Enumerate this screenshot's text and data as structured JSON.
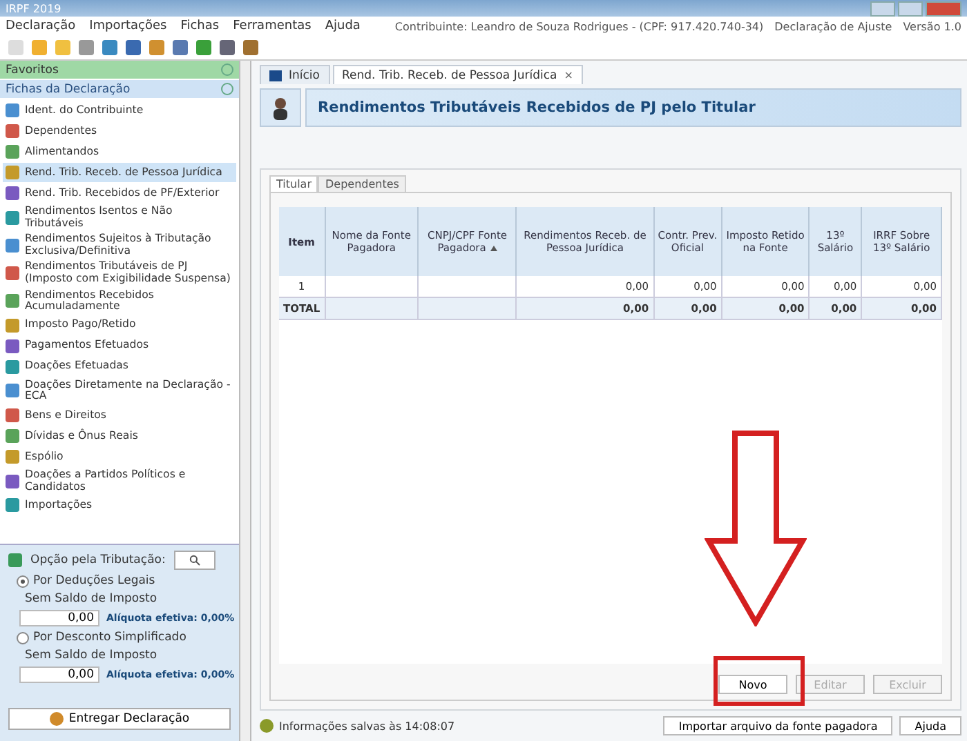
{
  "window": {
    "title": "IRPF 2019"
  },
  "menu": [
    "Declaração",
    "Importações",
    "Fichas",
    "Ferramentas",
    "Ajuda"
  ],
  "header_info": {
    "taxpayer": "Contribuinte: Leandro de Souza Rodrigues - (CPF: 917.420.740-34)",
    "declaration": "Declaração de Ajuste",
    "version": "Versão 1.0"
  },
  "sidebar": {
    "favorites": "Favoritos",
    "section": "Fichas da Declaração",
    "items": [
      {
        "label": "Ident. do Contribuinte",
        "selected": false
      },
      {
        "label": "Dependentes",
        "selected": false
      },
      {
        "label": "Alimentandos",
        "selected": false
      },
      {
        "label": "Rend. Trib. Receb. de Pessoa Jurídica",
        "selected": true
      },
      {
        "label": "Rend. Trib. Recebidos de PF/Exterior",
        "selected": false
      },
      {
        "label": "Rendimentos Isentos e Não Tributáveis",
        "selected": false
      },
      {
        "label": "Rendimentos Sujeitos à Tributação Exclusiva/Definitiva",
        "selected": false
      },
      {
        "label": "Rendimentos Tributáveis de PJ (Imposto com Exigibilidade Suspensa)",
        "selected": false
      },
      {
        "label": "Rendimentos Recebidos Acumuladamente",
        "selected": false
      },
      {
        "label": "Imposto Pago/Retido",
        "selected": false
      },
      {
        "label": "Pagamentos Efetuados",
        "selected": false
      },
      {
        "label": "Doações Efetuadas",
        "selected": false
      },
      {
        "label": "Doações Diretamente na Declaração - ECA",
        "selected": false
      },
      {
        "label": "Bens e Direitos",
        "selected": false
      },
      {
        "label": "Dívidas e Ônus Reais",
        "selected": false
      },
      {
        "label": "Espólio",
        "selected": false
      },
      {
        "label": "Doações a Partidos Políticos e Candidatos",
        "selected": false
      },
      {
        "label": "Importações",
        "selected": false
      }
    ]
  },
  "taxation": {
    "title": "Opção pela Tributação:",
    "options": [
      {
        "label": "Por Deduções Legais",
        "selected": true,
        "caption": "Sem Saldo de Imposto",
        "value": "0,00",
        "rate": "Alíquota efetiva: 0,00%"
      },
      {
        "label": "Por Desconto Simplificado",
        "selected": false,
        "caption": "Sem Saldo de Imposto",
        "value": "0,00",
        "rate": "Alíquota efetiva: 0,00%"
      }
    ],
    "submit": "Entregar Declaração"
  },
  "doc_tabs": [
    {
      "label": "Início",
      "selected": false,
      "closable": false
    },
    {
      "label": "Rend. Trib. Receb. de Pessoa Jurídica",
      "selected": true,
      "closable": true
    }
  ],
  "close_glyph": "×",
  "page_title": "Rendimentos Tributáveis Recebidos de PJ pelo Titular",
  "sub_tabs": [
    {
      "label": "Titular",
      "selected": true
    },
    {
      "label": "Dependentes",
      "selected": false
    }
  ],
  "table": {
    "columns": [
      "Item",
      "Nome da Fonte Pagadora",
      "CNPJ/CPF Fonte Pagadora",
      "Rendimentos Receb. de Pessoa Jurídica",
      "Contr. Prev. Oficial",
      "Imposto Retido na Fonte",
      "13º Salário",
      "IRRF Sobre 13º Salário"
    ],
    "rows": [
      {
        "item": "1",
        "values": [
          "0,00",
          "0,00",
          "0,00",
          "0,00",
          "0,00"
        ],
        "total": false
      },
      {
        "item": "TOTAL",
        "values": [
          "0,00",
          "0,00",
          "0,00",
          "0,00",
          "0,00"
        ],
        "total": true
      }
    ]
  },
  "actions": [
    {
      "label": "Novo",
      "disabled": false
    },
    {
      "label": "Editar",
      "disabled": true
    },
    {
      "label": "Excluir",
      "disabled": true
    }
  ],
  "status": "Informações salvas às 14:08:07",
  "footer_buttons": [
    "Importar arquivo da fonte pagadora",
    "Ajuda"
  ]
}
